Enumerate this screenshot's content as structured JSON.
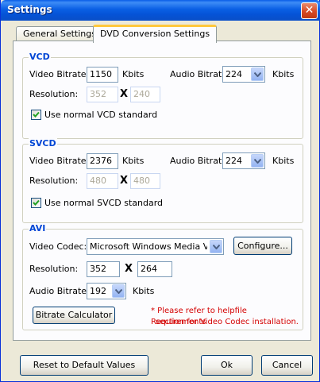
{
  "window": {
    "title": "Settings",
    "close_glyph": "✕"
  },
  "tabs": [
    {
      "label": "General Settings",
      "active": false
    },
    {
      "label": "DVD Conversion Settings",
      "active": true
    }
  ],
  "vcd": {
    "legend": "VCD",
    "video_bitrate_label": "Video Bitrate:",
    "video_bitrate_value": "1150",
    "video_unit": "Kbits",
    "audio_bitrate_label": "Audio Bitrate:",
    "audio_bitrate_value": "224",
    "audio_unit": "Kbits",
    "resolution_label": "Resolution:",
    "res_width": "352",
    "res_height": "240",
    "times": "X",
    "checkbox_label": "Use normal VCD standard",
    "checkbox_checked": true
  },
  "svcd": {
    "legend": "SVCD",
    "video_bitrate_label": "Video Bitrate:",
    "video_bitrate_value": "2376",
    "video_unit": "Kbits",
    "audio_bitrate_label": "Audio Bitrate:",
    "audio_bitrate_value": "224",
    "audio_unit": "Kbits",
    "resolution_label": "Resolution:",
    "res_width": "480",
    "res_height": "480",
    "times": "X",
    "checkbox_label": "Use normal SVCD standard",
    "checkbox_checked": true
  },
  "avi": {
    "legend": "AVI",
    "video_codec_label": "Video Codec:",
    "video_codec_value": "Microsoft Windows Media Video",
    "configure_label": "Configure...",
    "resolution_label": "Resolution:",
    "res_width": "352",
    "res_height": "264",
    "times": "X",
    "audio_bitrate_label": "Audio Bitrate:",
    "audio_bitrate_value": "192",
    "audio_unit": "Kbits",
    "calculator_label": "Bitrate Calculator",
    "note_line1": "* Please  refer to helpfile Requirements",
    "note_line2": "section for Video Codec installation."
  },
  "footer": {
    "reset_label": "Reset to Default Values",
    "ok_label": "Ok",
    "cancel_label": "Cancel"
  },
  "colors": {
    "titlebar": "#0a5fe4",
    "group_legend": "#0046d5",
    "note_text": "#d40000",
    "face": "#ece9d8"
  }
}
